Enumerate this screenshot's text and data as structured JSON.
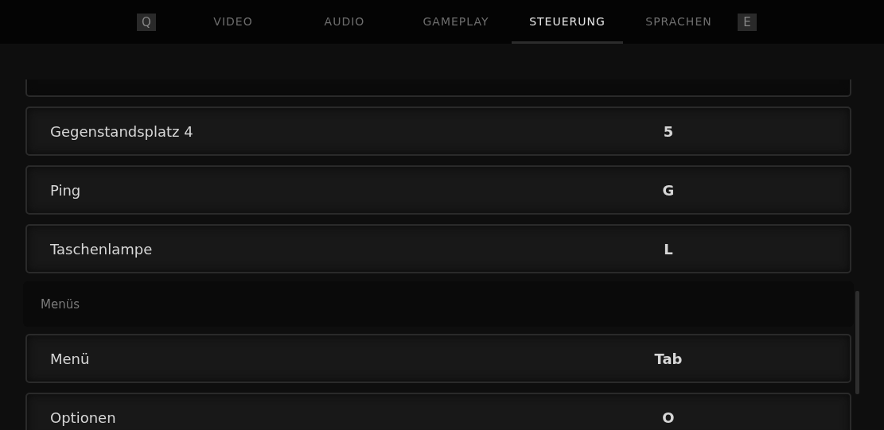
{
  "tab_bar": {
    "prev_key": "Q",
    "next_key": "E",
    "tabs": [
      {
        "label": "VIDEO",
        "selected": false
      },
      {
        "label": "AUDIO",
        "selected": false
      },
      {
        "label": "GAMEPLAY",
        "selected": false
      },
      {
        "label": "STEUERUNG",
        "selected": true
      },
      {
        "label": "SPRACHEN",
        "selected": false
      }
    ]
  },
  "bindings": [
    {
      "kind": "binding",
      "action": "Gegenstandsplatz 4",
      "key": "5"
    },
    {
      "kind": "binding",
      "action": "Ping",
      "key": "G"
    },
    {
      "kind": "binding",
      "action": "Taschenlampe",
      "key": "L"
    },
    {
      "kind": "section",
      "title": "Menüs"
    },
    {
      "kind": "binding",
      "action": "Menü",
      "key": "Tab"
    },
    {
      "kind": "binding",
      "action": "Optionen",
      "key": "O"
    }
  ]
}
